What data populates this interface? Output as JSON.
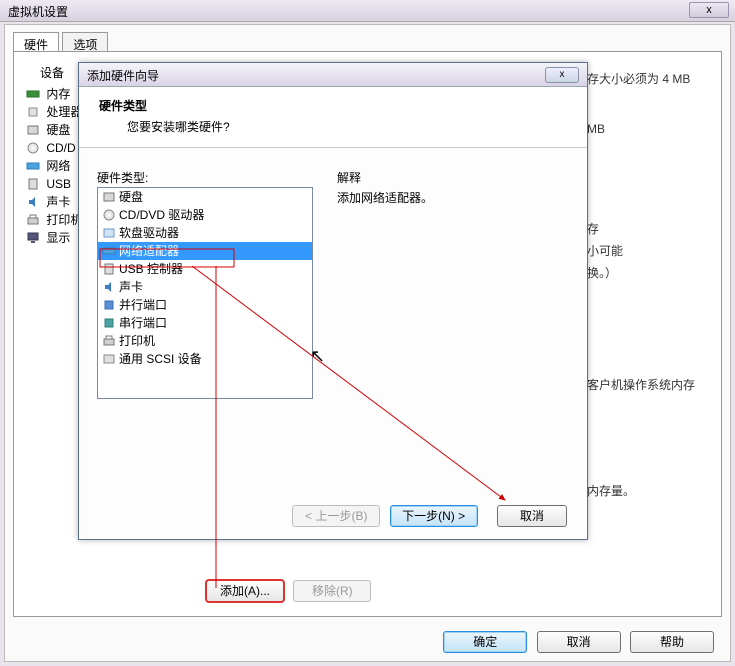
{
  "outer": {
    "title": "虚拟机设置",
    "close": "x",
    "tabs": {
      "hardware": "硬件",
      "options": "选项"
    },
    "device_header": "设备",
    "devices": [
      {
        "label": "内存"
      },
      {
        "label": "处理器"
      },
      {
        "label": "硬盘"
      },
      {
        "label": "CD/D"
      },
      {
        "label": "网络"
      },
      {
        "label": "USB"
      },
      {
        "label": "声卡"
      },
      {
        "label": "打印机"
      },
      {
        "label": "显示"
      }
    ],
    "right_lines": [
      "存大小必须为 4 MB",
      "MB",
      "存",
      "小可能",
      "换。）",
      "客户机操作系统内存",
      "内存量。"
    ],
    "add": "添加(A)...",
    "remove": "移除(R)",
    "ok": "确定",
    "cancel": "取消",
    "help": "帮助"
  },
  "wizard": {
    "title": "添加硬件向导",
    "close": "x",
    "head_title": "硬件类型",
    "head_sub": "您要安装哪类硬件?",
    "hw_label": "硬件类型:",
    "items": [
      "硬盘",
      "CD/DVD 驱动器",
      "软盘驱动器",
      "网络适配器",
      "USB 控制器",
      "声卡",
      "并行端口",
      "串行端口",
      "打印机",
      "通用 SCSI 设备"
    ],
    "selected_index": 3,
    "explain_label": "解释",
    "explain_body": "添加网络适配器。",
    "back": "< 上一步(B)",
    "next": "下一步(N) >",
    "cancel": "取消"
  }
}
